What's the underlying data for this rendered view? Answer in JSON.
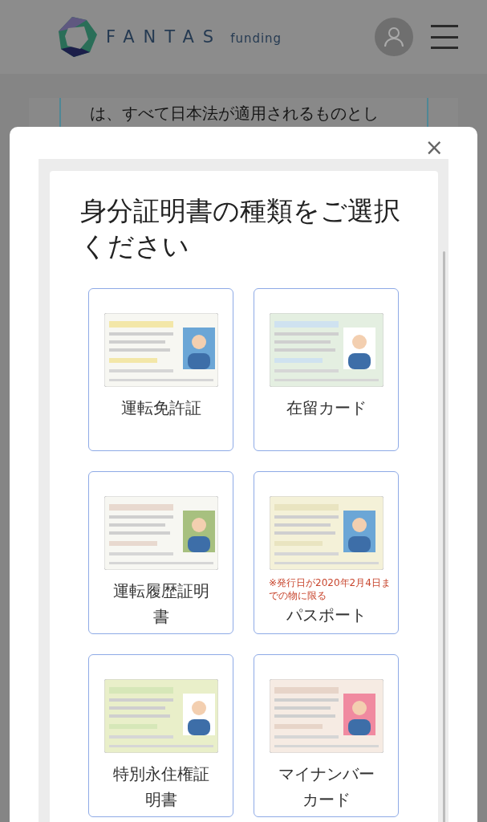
{
  "header": {
    "logo_text": "FANTAS",
    "logo_subtext": "funding"
  },
  "background_text": "は、すべて日本法が適用されるものとし",
  "modal": {
    "close": "×",
    "title": "身分証明書の種類をご選択ください",
    "options": [
      {
        "label": "運転免許証"
      },
      {
        "label": "在留カード"
      },
      {
        "label": "運転履歴証明書"
      },
      {
        "label": "パスポート",
        "note": "※発行日が2020年2月4日までの物に限る"
      },
      {
        "label": "特別永住権証明書"
      },
      {
        "label": "マイナンバーカード"
      }
    ]
  }
}
